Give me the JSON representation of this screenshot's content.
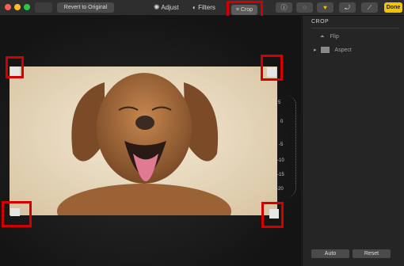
{
  "toolbar": {
    "revert_label": "Revert to Original",
    "adjust_label": "Adjust",
    "filters_label": "Filters",
    "crop_label": "Crop",
    "done_label": "Done"
  },
  "sidebar": {
    "title": "CROP",
    "flip_label": "Flip",
    "aspect_label": "Aspect",
    "auto_label": "Auto",
    "reset_label": "Reset"
  },
  "dial": {
    "ticks": [
      "5",
      "0",
      "-5",
      "-10",
      "-15",
      "-20"
    ]
  },
  "colors": {
    "done_yellow": "#f5c400",
    "favorite_yellow": "#f2c300",
    "annotation_red": "#d40000"
  }
}
